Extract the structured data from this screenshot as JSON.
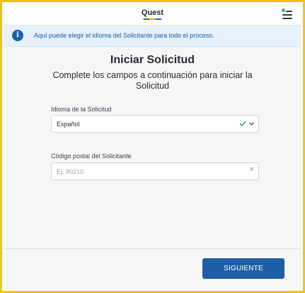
{
  "header": {
    "logo_text": "Quest",
    "menu_icon": "hamburger-menu-icon"
  },
  "banner": {
    "icon": "info-icon",
    "icon_glyph": "i",
    "text": "Aquí puede elegir el idioma del Solicitante para todo el proceso."
  },
  "main": {
    "title": "Iniciar Solicitud",
    "subtitle": "Complete los campos a continuación para iniciar la Solicitud",
    "language_field": {
      "label": "Idioma de la Solicitud",
      "value": "Español"
    },
    "zip_field": {
      "label": "Código postal del Solicitante",
      "placeholder": "Ej. 90210",
      "value": "",
      "required_glyph": "*"
    }
  },
  "footer": {
    "next_label": "SIGUIENTE"
  },
  "colors": {
    "frame_border": "#f2c40f",
    "primary_button": "#1f5ea8",
    "banner_bg": "#e6f1fb",
    "banner_text": "#1b5fa7",
    "valid_check": "#2e9e48"
  }
}
